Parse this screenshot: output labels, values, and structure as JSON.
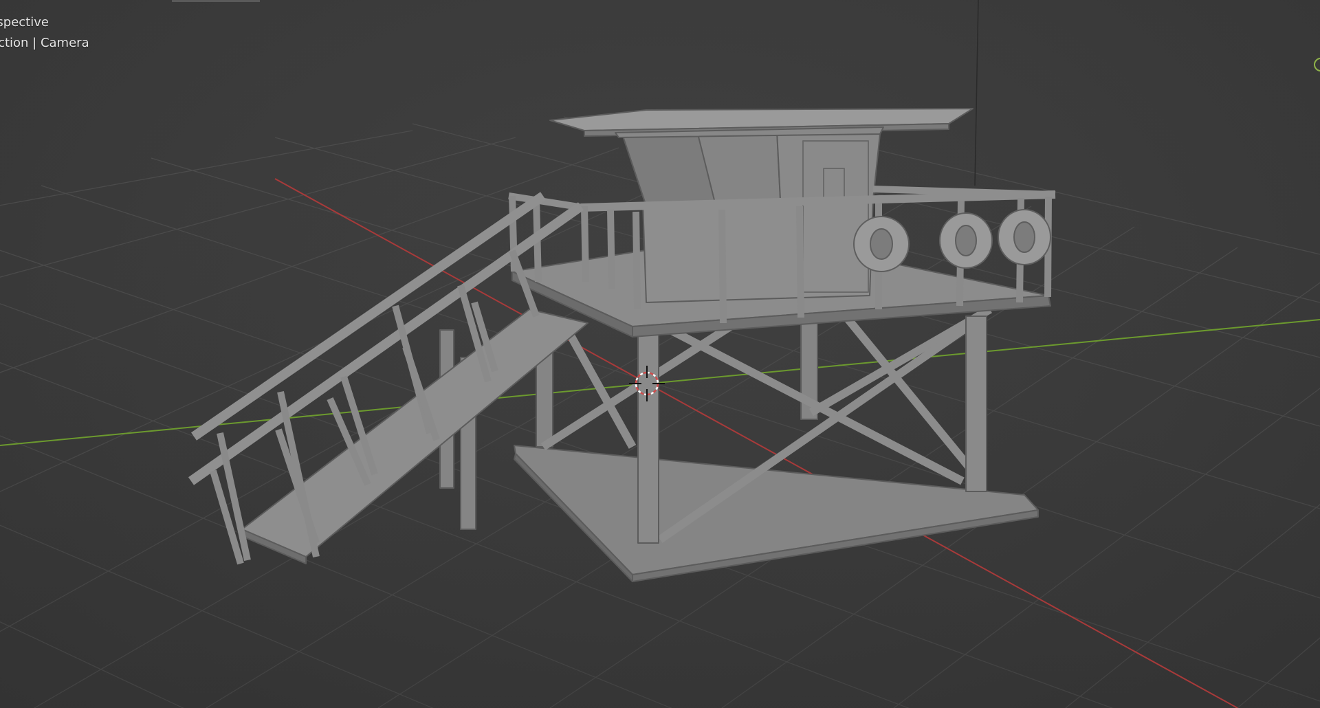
{
  "viewport": {
    "view_mode": "rspective",
    "view_context": "ection | Camera"
  },
  "colors": {
    "background": "#3a3a3a",
    "grid_line": "#4c4c4c",
    "x_axis": "#a83a3a",
    "y_axis": "#6c9a2e",
    "mesh_fill": "#8a8a8a",
    "mesh_edge": "#5c5c5c"
  },
  "icons": {
    "cursor": "3d-cursor-icon",
    "gizmo": "navigation-gizmo-icon"
  }
}
